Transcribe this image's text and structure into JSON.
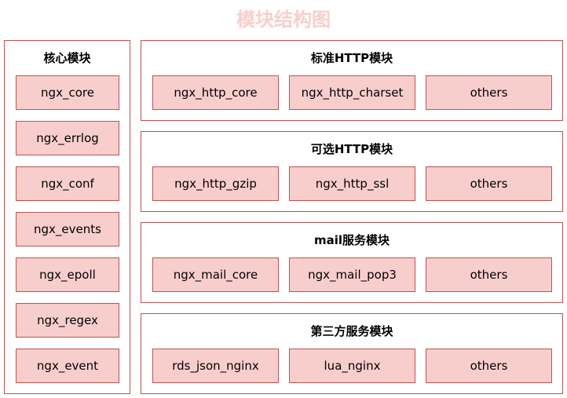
{
  "title": "模块结构图",
  "core": {
    "header": "核心模块",
    "items": [
      "ngx_core",
      "ngx_errlog",
      "ngx_conf",
      "ngx_events",
      "ngx_epoll",
      "ngx_regex",
      "ngx_event"
    ]
  },
  "groups": [
    {
      "header": "标准HTTP模块",
      "items": [
        "ngx_http_core",
        "ngx_http_charset",
        "others"
      ]
    },
    {
      "header": "可选HTTP模块",
      "items": [
        "ngx_http_gzip",
        "ngx_http_ssl",
        "others"
      ]
    },
    {
      "header": "mail服务模块",
      "items": [
        "ngx_mail_core",
        "ngx_mail_pop3",
        "others"
      ]
    },
    {
      "header": "第三方服务模块",
      "items": [
        "rds_json_nginx",
        "lua_nginx",
        "others"
      ]
    }
  ],
  "colors": {
    "title": "#f8cecc",
    "box_fill": "#f8cecc",
    "border": "#b85450"
  }
}
